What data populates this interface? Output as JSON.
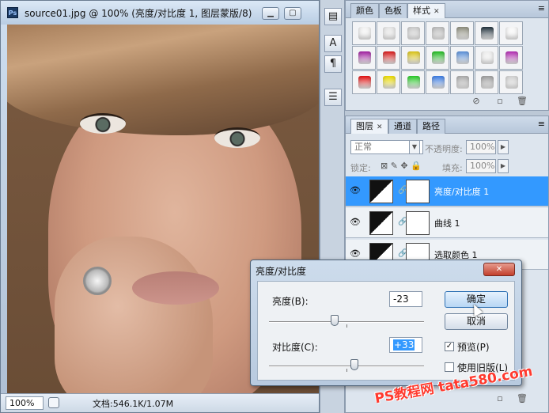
{
  "document": {
    "title": "source01.jpg @ 100% (亮度/对比度 1, 图层蒙版/8)",
    "ps_icon": "Ps",
    "zoom": "100%",
    "doc_size": "文档:546.1K/1.07M"
  },
  "styles_panel": {
    "tabs": [
      "颜色",
      "色板",
      "样式"
    ],
    "active_tab": "样式",
    "swatch_colors": [
      "#f2f2f2",
      "#e4e4e4",
      "#c9c9c9",
      "#b9b9b9",
      "#8a8a7a",
      "#1f2f3a",
      "#f7f7f7",
      "#a020a0",
      "#d41a1a",
      "#d8c21a",
      "#22b822",
      "#5a8ed6",
      "#eeeeee",
      "#b02cb0",
      "#e01010",
      "#e8d800",
      "#28c828",
      "#3a7ae0",
      "#a9a9a9",
      "#9c9c9c",
      "#d0d0d0"
    ]
  },
  "layers_panel": {
    "tabs": [
      "图层",
      "通道",
      "路径"
    ],
    "active_tab": "图层",
    "blend_mode": "正常",
    "opacity_label": "不透明度:",
    "opacity_value": "100%",
    "lock_label": "锁定:",
    "fill_label": "填充:",
    "fill_value": "100%",
    "layers": [
      {
        "name": "亮度/对比度 1",
        "selected": true
      },
      {
        "name": "曲线 1",
        "selected": false
      },
      {
        "name": "选取颜色 1",
        "selected": false
      }
    ]
  },
  "dialog": {
    "title": "亮度/对比度",
    "brightness_label": "亮度(B):",
    "brightness_value": "-23",
    "contrast_label": "对比度(C):",
    "contrast_value": "+33",
    "ok_label": "确定",
    "cancel_label": "取消",
    "preview_label": "预览(P)",
    "preview_checked": true,
    "legacy_label": "使用旧版(L)",
    "legacy_checked": false
  },
  "watermark": "PS教程网 tata580.com"
}
